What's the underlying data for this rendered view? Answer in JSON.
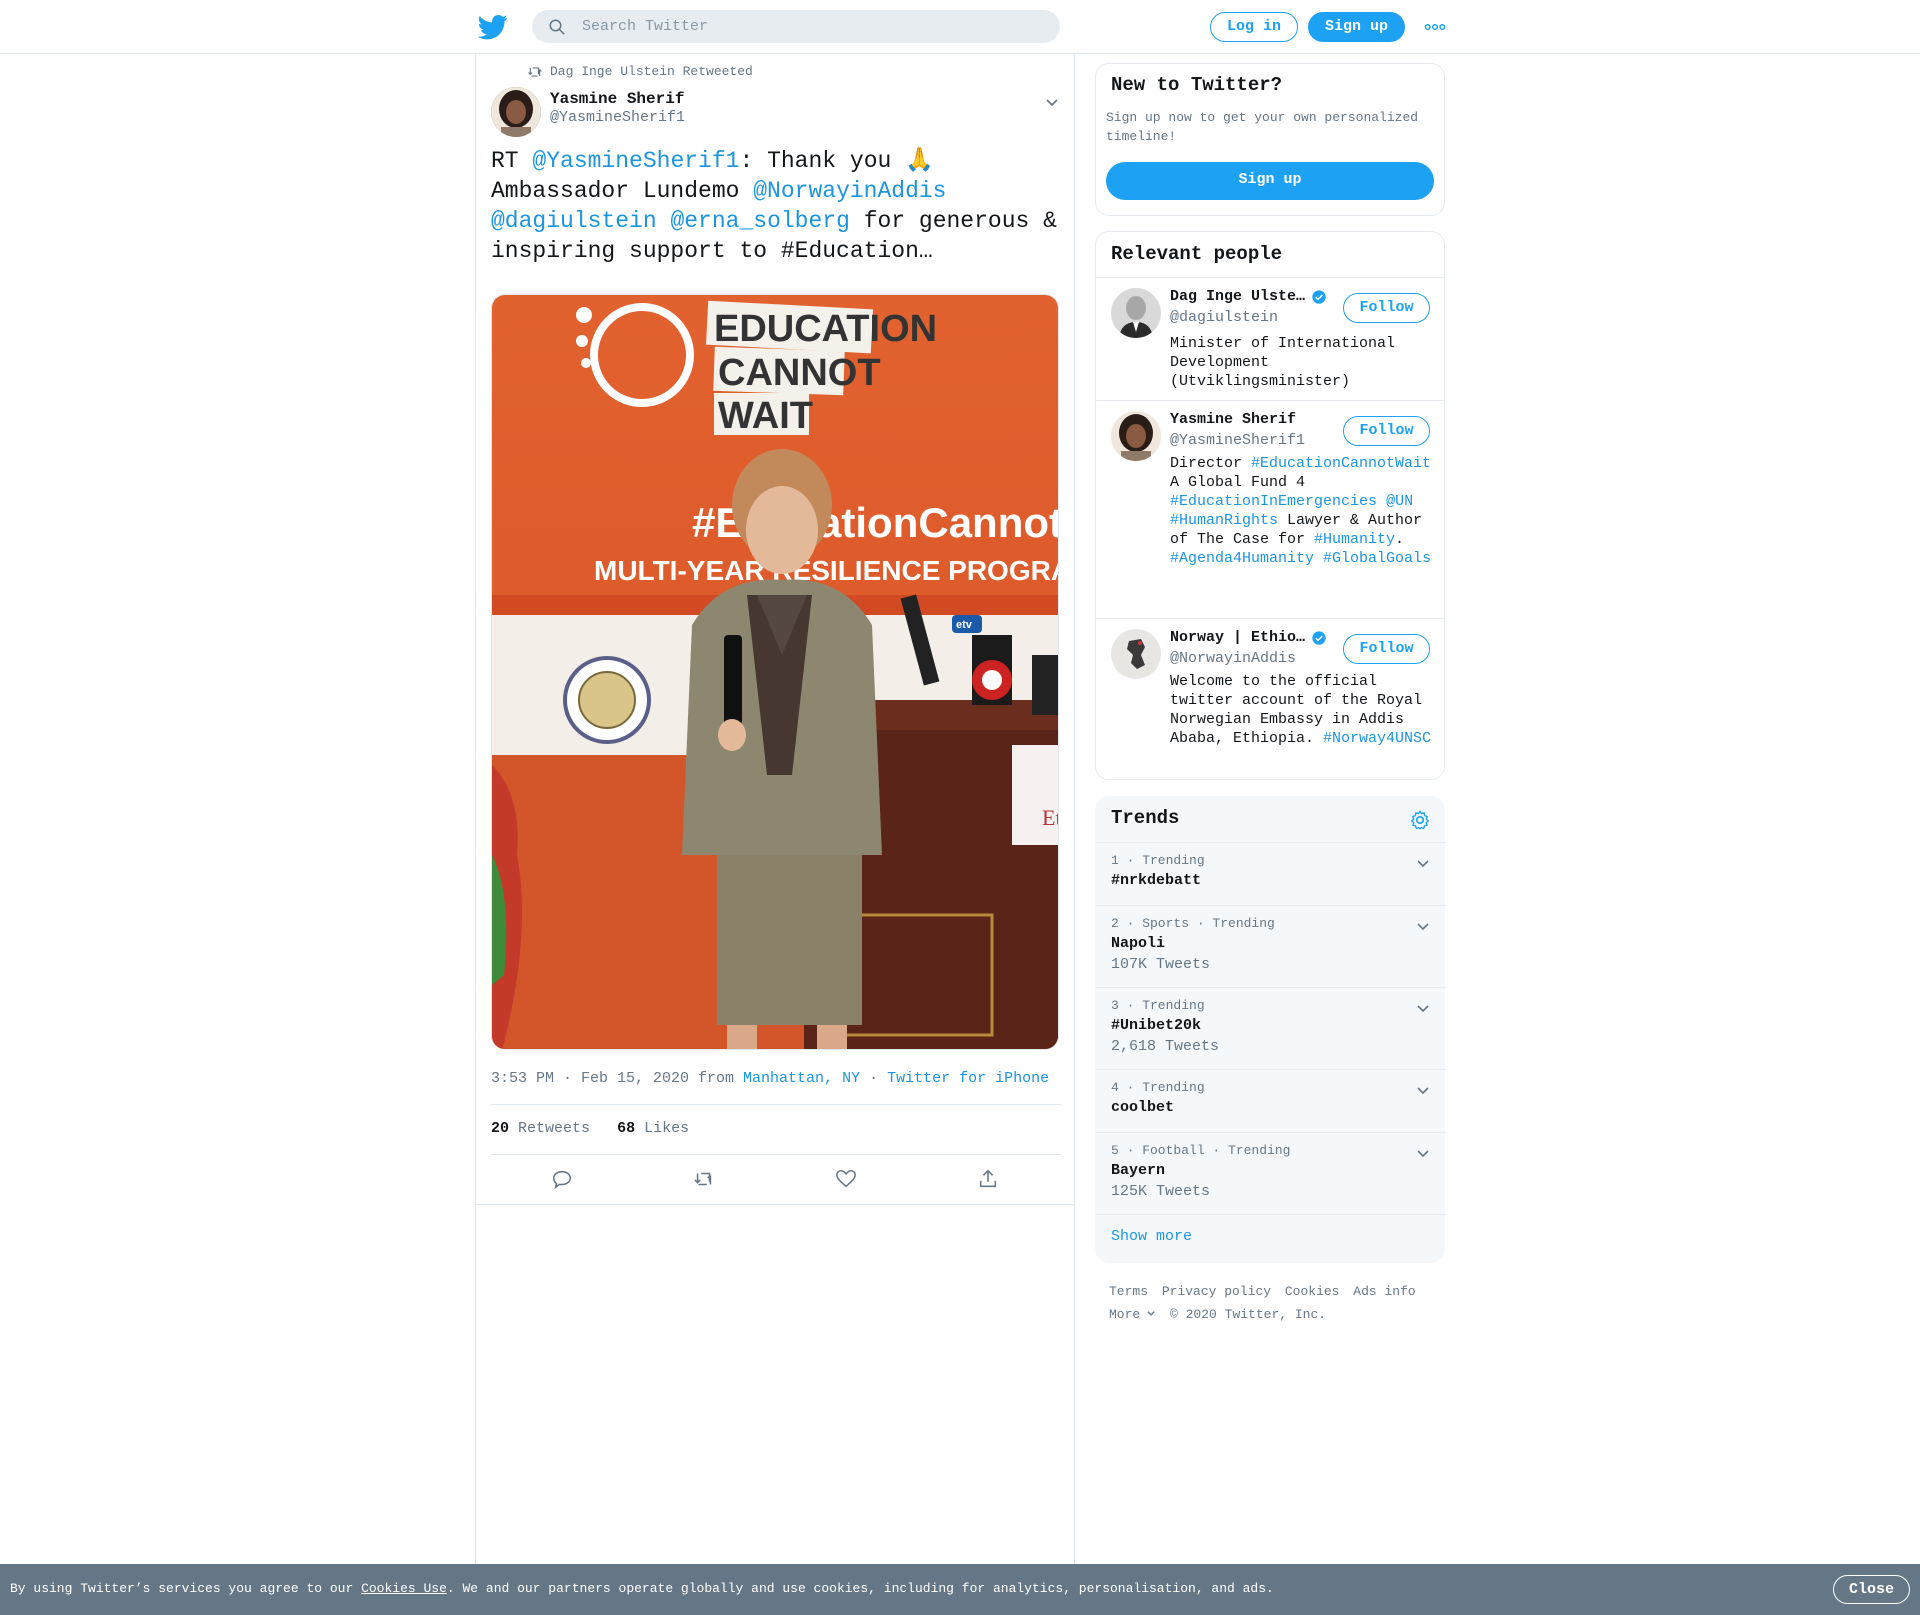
{
  "header": {
    "search_placeholder": "Search Twitter",
    "login_label": "Log in",
    "signup_label": "Sign up"
  },
  "tweet": {
    "retweeted_by": "Dag Inge Ulstein Retweeted",
    "author_name": "Yasmine Sherif",
    "author_handle": "@YasmineSherif1",
    "text_parts": {
      "p1": "RT ",
      "m1": "@YasmineSherif1",
      "p2": ": Thank you 🙏 Ambassador Lundemo ",
      "m2": "@NorwayinAddis",
      "p3": " ",
      "m3": "@dagiulstein",
      "p4": " ",
      "m4": "@erna_solberg",
      "p5": " for generous & inspiring support to #Education…"
    },
    "image_texts": {
      "line1": "EDUCATION",
      "line2": "CANNOT",
      "line3": "WAIT",
      "hashtag": "#EducationCannotWait",
      "banner": "MULTI-YEAR RESILIENCE PROGRAMME",
      "mic1": "etv",
      "podium": "Eth"
    },
    "time": "3:53 PM · Feb 15, 2020 from ",
    "location": "Manhattan, NY",
    "sep": " · ",
    "source": "Twitter for iPhone",
    "retweets": "20",
    "retweets_label": "Retweets",
    "likes": "68",
    "likes_label": "Likes"
  },
  "new_to_twitter": {
    "title": "New to Twitter?",
    "text": "Sign up now to get your own personalized timeline!",
    "button": "Sign up"
  },
  "relevant_people": {
    "title": "Relevant people",
    "follow_label": "Follow",
    "people": [
      {
        "name": "Dag Inge Ulste…",
        "handle": "@dagiulstein",
        "bio": "Minister of International Development (Utviklingsminister)"
      },
      {
        "name": "Yasmine Sherif",
        "handle": "@YasmineSherif1",
        "bio_parts": {
          "a": "Director ",
          "b": "#EducationCannotWait",
          "c": " A Global Fund 4 ",
          "d": "#EducationInEmergencies",
          "e": " ",
          "f": "@UN",
          "g": " ",
          "h": "#HumanRights",
          "i": " Lawyer & Author of The Case for ",
          "j": "#Humanity",
          "k": ". ",
          "l": "#Agenda4Humanity",
          "m": " ",
          "n": "#GlobalGoals"
        }
      },
      {
        "name": "Norway | Ethio…",
        "handle": "@NorwayinAddis",
        "bio": "Welcome to the official twitter account of the Royal Norwegian Embassy in Addis Ababa, Ethiopia. ",
        "bio_tag": "#Norway4UNSC"
      }
    ]
  },
  "trends": {
    "title": "Trends",
    "items": [
      {
        "meta": "1 · Trending",
        "name": "#nrkdebatt",
        "count": ""
      },
      {
        "meta": "2 · Sports · Trending",
        "name": "Napoli",
        "count": "107K Tweets"
      },
      {
        "meta": "3 · Trending",
        "name": "#Unibet20k",
        "count": "2,618 Tweets"
      },
      {
        "meta": "4 · Trending",
        "name": "coolbet",
        "count": ""
      },
      {
        "meta": "5 · Football · Trending",
        "name": "Bayern",
        "count": "125K Tweets"
      }
    ],
    "show_more": "Show more"
  },
  "footer": {
    "terms": "Terms",
    "privacy": "Privacy policy",
    "cookies": "Cookies",
    "ads": "Ads info",
    "more": "More",
    "copyright": "© 2020 Twitter, Inc."
  },
  "cookie_bar": {
    "text_before": "By using Twitter’s services you agree to our ",
    "link": "Cookies Use",
    "text_after": ". We and our partners operate globally and use cookies, including for analytics, personalisation, and ads.",
    "close": "Close"
  },
  "colors": {
    "brand_blue": "#1da1f2",
    "link_blue": "#1b95e0",
    "muted": "#657786",
    "cookie_bg": "#657786"
  },
  "icons": [
    "twitter-logo-icon",
    "search-icon",
    "more-dots-icon",
    "retweet-icon",
    "chevron-down-icon",
    "reply-icon",
    "like-icon",
    "share-icon",
    "verified-icon",
    "gear-icon"
  ]
}
